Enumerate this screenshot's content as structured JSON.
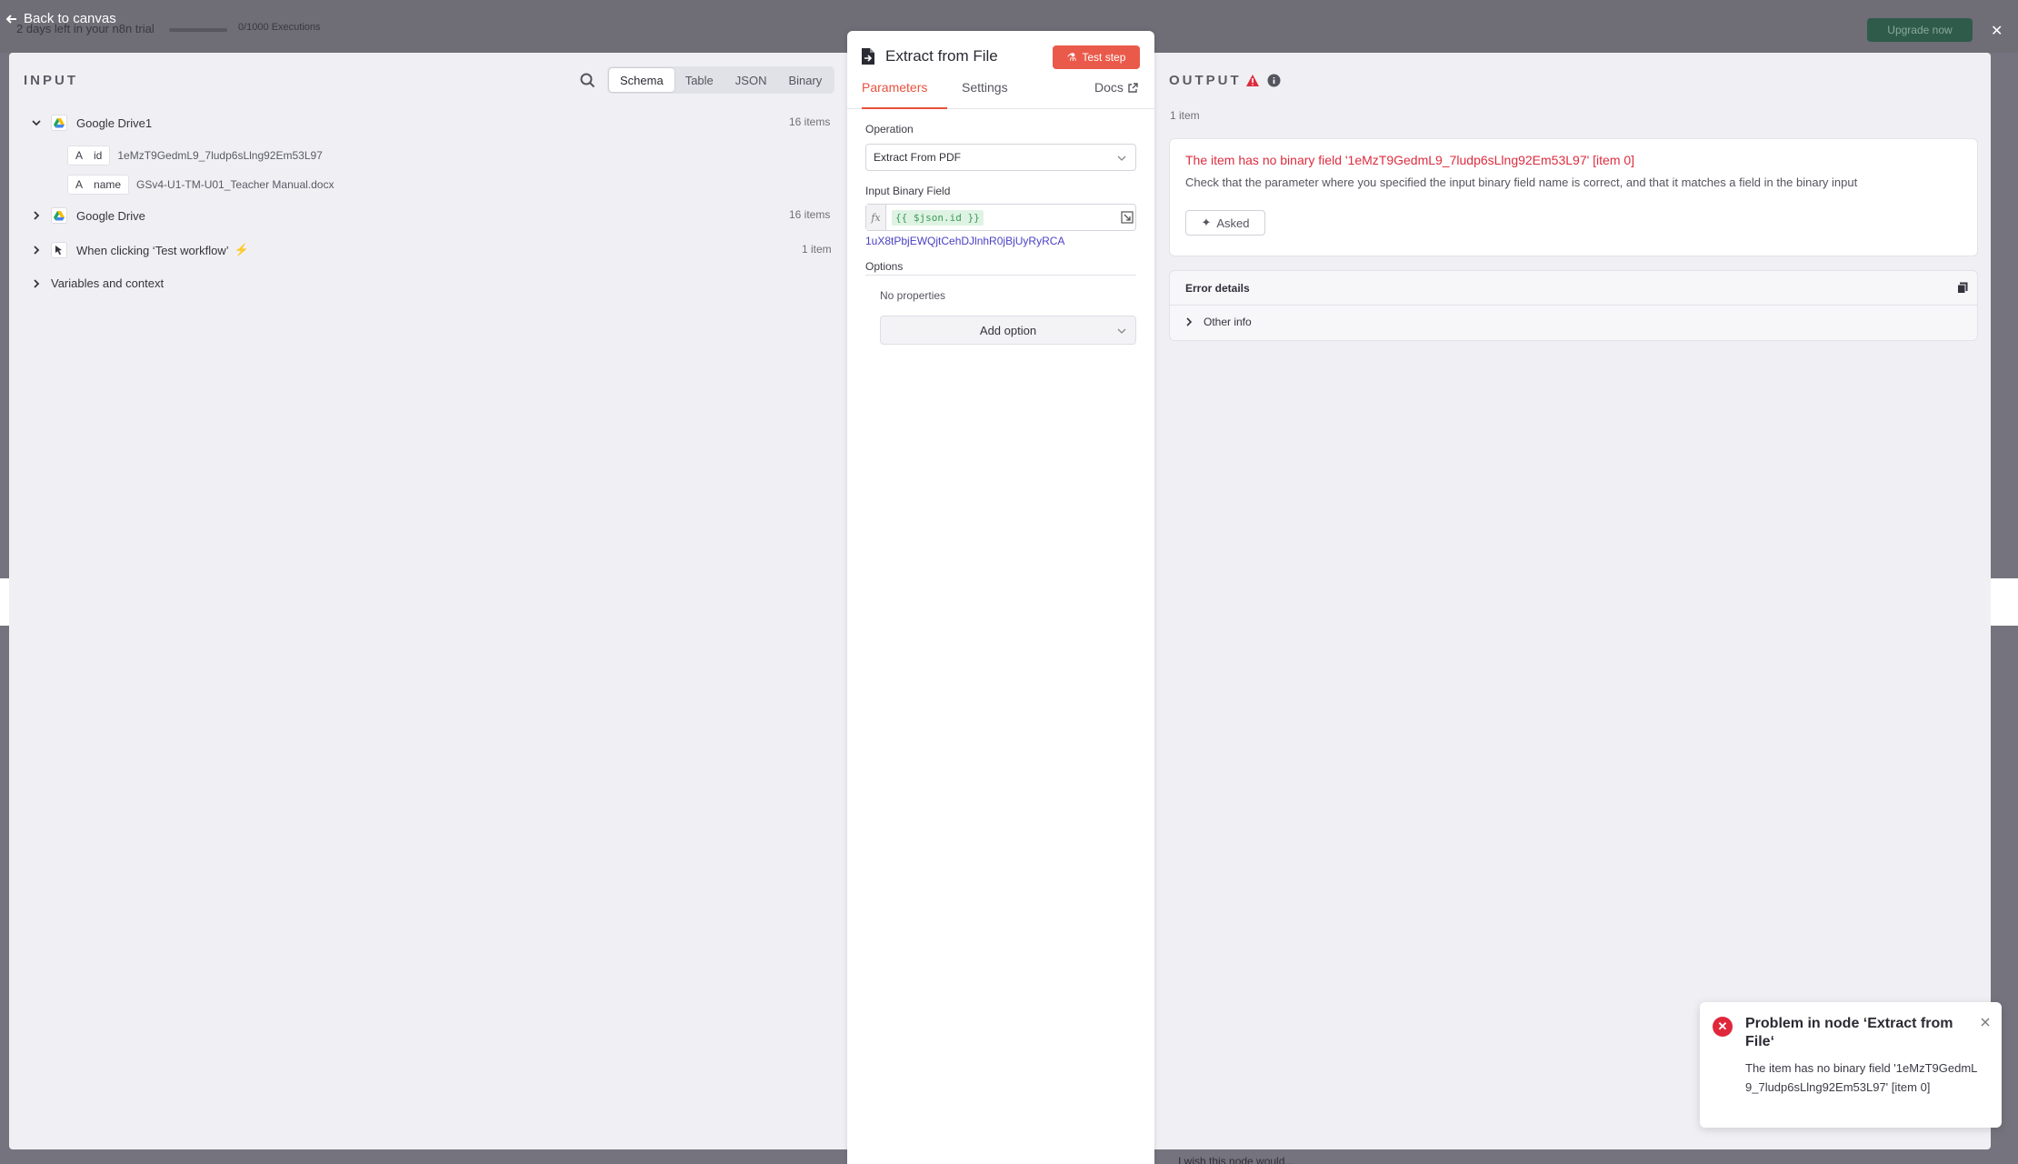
{
  "background": {
    "trial_text": "2 days left in your n8n trial",
    "executions": "0/1000 Executions",
    "upgrade_label": "Upgrade now",
    "bottom_text": "I wish this node would..."
  },
  "back_link": {
    "label": "Back to canvas"
  },
  "input": {
    "title": "INPUT",
    "view_tabs": [
      "Schema",
      "Table",
      "JSON",
      "Binary"
    ],
    "active_view": "Schema",
    "tree": [
      {
        "label": "Google Drive1",
        "count": "16 items",
        "expanded": true,
        "fields": [
          {
            "type": "A",
            "key": "id",
            "value": "1eMzT9GedmL9_7ludp6sLlng92Em53L97"
          },
          {
            "type": "A",
            "key": "name",
            "value": "GSv4-U1-TM-U01_Teacher Manual.docx"
          }
        ]
      },
      {
        "label": "Google Drive",
        "count": "16 items"
      },
      {
        "label": "When clicking ‘Test workflow’",
        "count": "1 item"
      }
    ],
    "variables_label": "Variables and context"
  },
  "node": {
    "title": "Extract from File",
    "test_label": "Test step",
    "tabs": [
      "Parameters",
      "Settings"
    ],
    "docs_label": "Docs",
    "operation_label": "Operation",
    "operation_value": "Extract From PDF",
    "binary_field_label": "Input Binary Field",
    "binary_field_expr": "{{ $json.id }}",
    "binary_field_resolved": "1uX8tPbjEWQjtCehDJlnhR0jBjUyRyRCA",
    "options_label": "Options",
    "no_properties": "No properties",
    "add_option_label": "Add option"
  },
  "output": {
    "title": "OUTPUT",
    "items_count": "1 item",
    "error_title": "The item has no binary field '1eMzT9GedmL9_7ludp6sLlng92Em53L97' [item 0]",
    "error_desc": "Check that the parameter where you specified the input binary field name is correct, and that it matches a field in the binary input",
    "asked_label": "Asked",
    "details_title": "Error details",
    "other_info_label": "Other info"
  },
  "toast": {
    "title": "Problem in node ‘Extract from File‘",
    "body": "The item has no binary field '1eMzT9GedmL9_7ludp6sLlng92Em53L97' [item 0]"
  },
  "colors": {
    "accent": "#e8523d",
    "error": "#dd2c3e",
    "link": "#4a3fc3"
  }
}
